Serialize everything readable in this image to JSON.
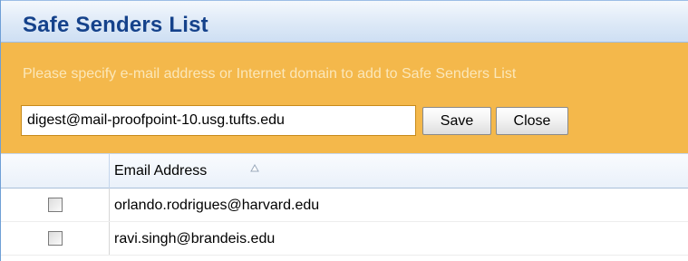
{
  "panel": {
    "title": "Safe Senders List",
    "instructions": "Please specify e-mail address or Internet domain to add to Safe Senders List"
  },
  "form": {
    "email_value": "digest@mail-proofpoint-10.usg.tufts.edu",
    "save_label": "Save",
    "close_label": "Close"
  },
  "table": {
    "columns": [
      {
        "label": "",
        "type": "checkbox"
      },
      {
        "label": "Email Address",
        "sort": "ascending",
        "sort_icon": "sort-ascending-icon"
      }
    ],
    "rows": [
      {
        "checked": false,
        "email": "orlando.rodrigues@harvard.edu"
      },
      {
        "checked": false,
        "email": "ravi.singh@brandeis.edu"
      }
    ]
  },
  "colors": {
    "title_text": "#15428b",
    "orange_band": "#f4b84b",
    "border_blue": "#6f9fd6"
  }
}
